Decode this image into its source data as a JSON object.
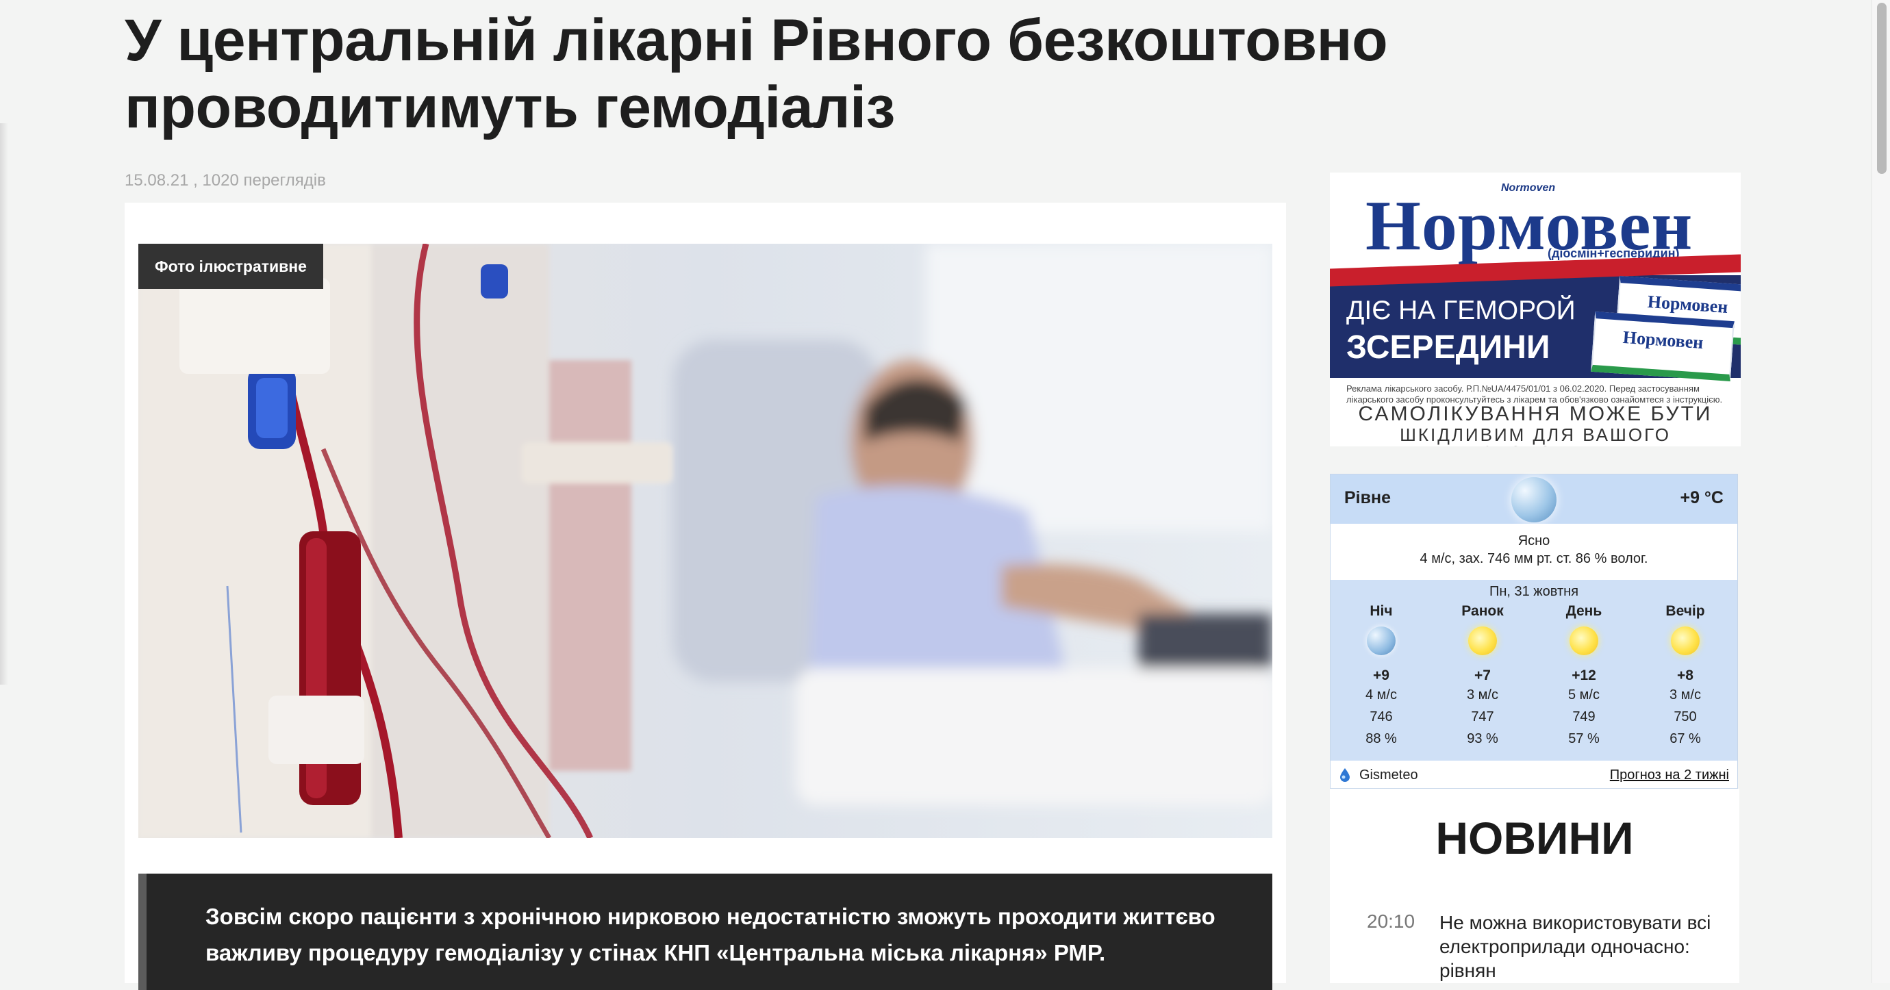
{
  "article": {
    "title": "У центральній лікарні Рівного безкоштовно проводитимуть гемодіаліз",
    "meta": "15.08.21 , 1020 переглядів",
    "photo_badge": "Фото ілюстративне",
    "lead": "Зовсім скоро пацієнти з хронічною нирковою недостатністю зможуть проходити життєво важливу процедуру гемодіалізу у стінах КНП «Центральна міська лікарня» РМР."
  },
  "ad": {
    "brand_small": "Normoven",
    "brand": "Нормовен",
    "ingredients": "(діосмін+гесперидин)",
    "slogan_line1": "ДІЄ НА ГЕМОРОЙ",
    "slogan_line2": "ЗСЕРЕДИНИ",
    "box_label": "Нормовен",
    "fine_print": "Реклама лікарського засобу. Р.П.№UA/4475/01/01 з 06.02.2020. Перед застосуванням лікарського засобу проконсультуйтесь з лікарем та обов'язково ознайомтеся з інструкцією.",
    "warning_line1": "САМОЛІКУВАННЯ МОЖЕ БУТИ",
    "warning_line2": "ШКІДЛИВИМ ДЛЯ ВАШОГО ЗДОРОВ'Я",
    "colors": {
      "brand_blue": "#1c3a8b",
      "band": "#1f2f6b",
      "accent_red": "#c91f2c",
      "accent_green": "#2a9a4b"
    }
  },
  "weather": {
    "city": "Рівне",
    "temp": "+9 °C",
    "current_icon": "moon-clear-icon",
    "condition": "Ясно",
    "details": "4 м/с, зах.   746 мм рт. ст.   86 % волог.",
    "date": "Пн, 31 жовтня",
    "periods": [
      {
        "name": "Ніч",
        "icon": "moon",
        "temp": "+9",
        "wind": "4 м/с",
        "pressure": "746",
        "humidity": "88 %"
      },
      {
        "name": "Ранок",
        "icon": "sun",
        "temp": "+7",
        "wind": "3 м/с",
        "pressure": "747",
        "humidity": "93 %"
      },
      {
        "name": "День",
        "icon": "sun",
        "temp": "+12",
        "wind": "5 м/с",
        "pressure": "749",
        "humidity": "57 %"
      },
      {
        "name": "Вечір",
        "icon": "sun",
        "temp": "+8",
        "wind": "3 м/с",
        "pressure": "750",
        "humidity": "67 %"
      }
    ],
    "provider": "Gismeteo",
    "forecast_link": "Прогноз на 2 тижні"
  },
  "news": {
    "title": "НОВИНИ",
    "items": [
      {
        "time": "20:10",
        "text": "Не можна використовувати всі електроприлади одночасно: рівнян"
      }
    ]
  }
}
